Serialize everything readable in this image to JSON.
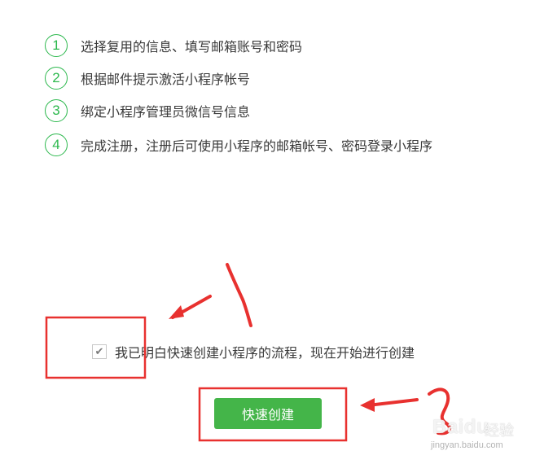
{
  "steps": [
    {
      "num": "1",
      "text": "选择复用的信息、填写邮箱账号和密码"
    },
    {
      "num": "2",
      "text": "根据邮件提示激活小程序帐号"
    },
    {
      "num": "3",
      "text": "绑定小程序管理员微信号信息"
    },
    {
      "num": "4",
      "text": "完成注册，注册后可使用小程序的邮箱帐号、密码登录小程序"
    }
  ],
  "agreement": {
    "checked": true,
    "label": "我已明白快速创建小程序的流程，现在开始进行创建"
  },
  "create_button": {
    "label": "快速创建"
  },
  "watermark": {
    "logo": "Baidu",
    "word": "经验",
    "url": "jingyan.baidu.com"
  },
  "colors": {
    "accent_green": "#44b549",
    "annotation_red": "#e8312f"
  }
}
